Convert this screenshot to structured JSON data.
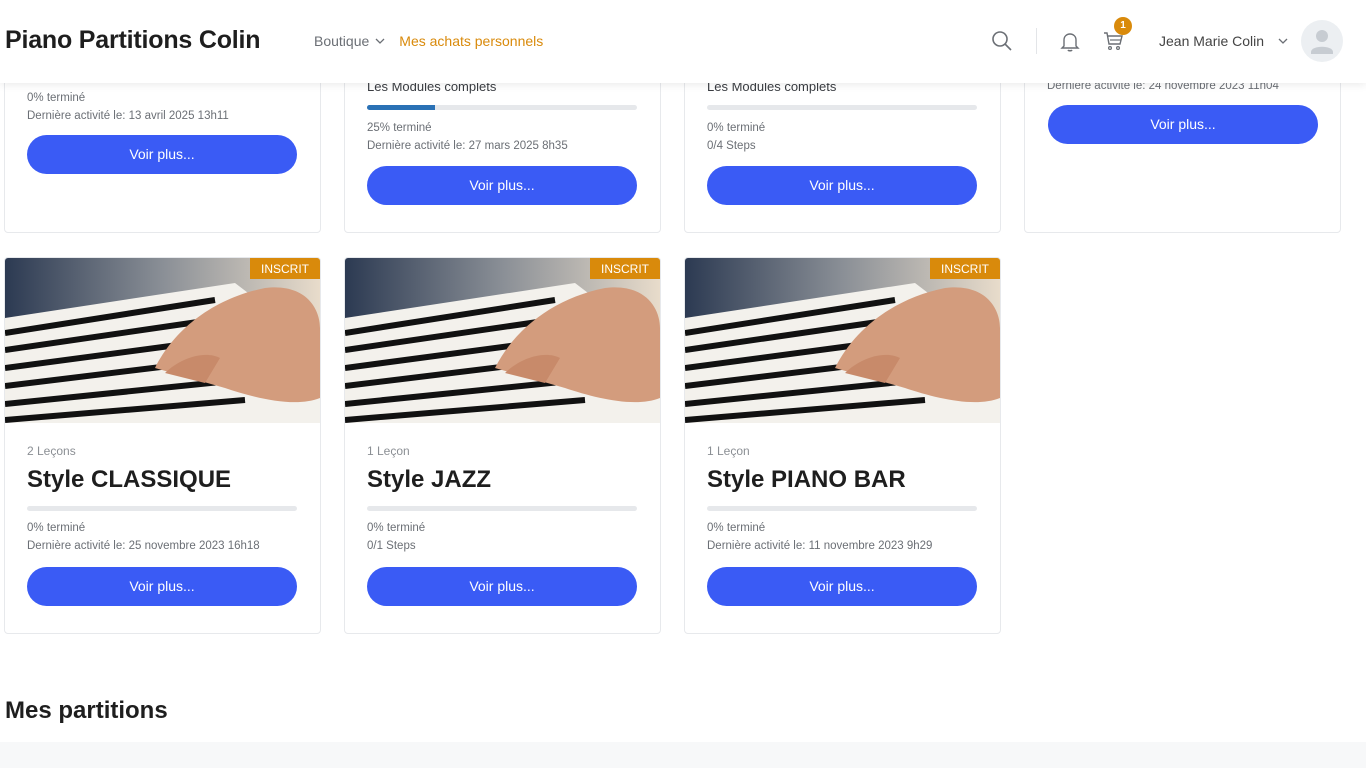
{
  "header": {
    "logo": "Piano Partitions Colin",
    "nav": [
      {
        "label": "Boutique",
        "active": false,
        "has_dropdown": true
      },
      {
        "label": "Mes achats personnels",
        "active": true,
        "has_dropdown": false
      }
    ],
    "cart_count": "1",
    "user_name": "Jean Marie Colin",
    "icons": [
      "search-icon",
      "bell-icon",
      "cart-icon",
      "chevron-down-icon",
      "avatar-icon"
    ]
  },
  "top_cards": [
    {
      "progress": "0% terminé",
      "activity": "Dernière activité le: 13 avril 2025 13h11",
      "button": "Voir plus..."
    },
    {
      "subtitle": "Les Modules complets",
      "progress_value": 25,
      "progress": "25% terminé",
      "activity": "Dernière activité le: 27 mars 2025 8h35",
      "button": "Voir plus..."
    },
    {
      "subtitle": "Les Modules complets",
      "progress_value": 0,
      "progress": "0% terminé",
      "activity": "0/4 Steps",
      "button": "Voir plus..."
    },
    {
      "activity": "Dernière activité le: 24 novembre 2023 11h04",
      "button": "Voir plus..."
    }
  ],
  "courses": [
    {
      "badge": "INSCRIT",
      "lessons": "2 Leçons",
      "title": "Style CLASSIQUE",
      "progress_value": 0,
      "progress": "0% terminé",
      "activity": "Dernière activité le: 25 novembre 2023 16h18",
      "button": "Voir plus..."
    },
    {
      "badge": "INSCRIT",
      "lessons": "1 Leçon",
      "title": "Style JAZZ",
      "progress_value": 0,
      "progress": "0% terminé",
      "activity": "0/1 Steps",
      "button": "Voir plus..."
    },
    {
      "badge": "INSCRIT",
      "lessons": "1 Leçon",
      "title": "Style PIANO BAR",
      "progress_value": 0,
      "progress": "0% terminé",
      "activity": "Dernière activité le: 11 novembre 2023 9h29",
      "button": "Voir plus..."
    }
  ],
  "section": {
    "title": "Mes partitions"
  },
  "colors": {
    "accent": "#d98a0b",
    "button": "#3a5bf5",
    "progress": "#2a71b5"
  }
}
